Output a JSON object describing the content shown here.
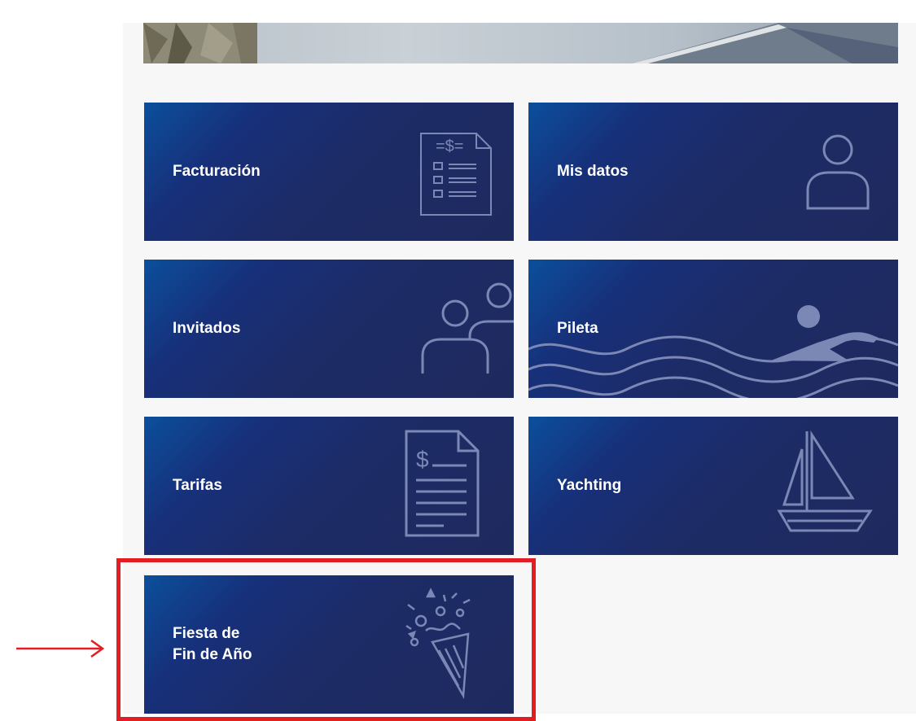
{
  "tiles": [
    {
      "label": "Facturación",
      "icon": "invoice-icon"
    },
    {
      "label": "Mis datos",
      "icon": "user-icon"
    },
    {
      "label": "Invitados",
      "icon": "guests-icon"
    },
    {
      "label": "Pileta",
      "icon": "swimmer-icon"
    },
    {
      "label": "Tarifas",
      "icon": "rates-document-icon"
    },
    {
      "label": "Yachting",
      "icon": "sailboat-icon"
    },
    {
      "label": "Fiesta de\nFin de Año",
      "icon": "party-popper-icon"
    }
  ],
  "colors": {
    "tile_dark": "#1e2a5e",
    "tile_accent": "#0b4f9c",
    "icon_stroke": "#7b87b5",
    "annotation_red": "#e21d23",
    "panel_bg": "#f7f7f7"
  }
}
